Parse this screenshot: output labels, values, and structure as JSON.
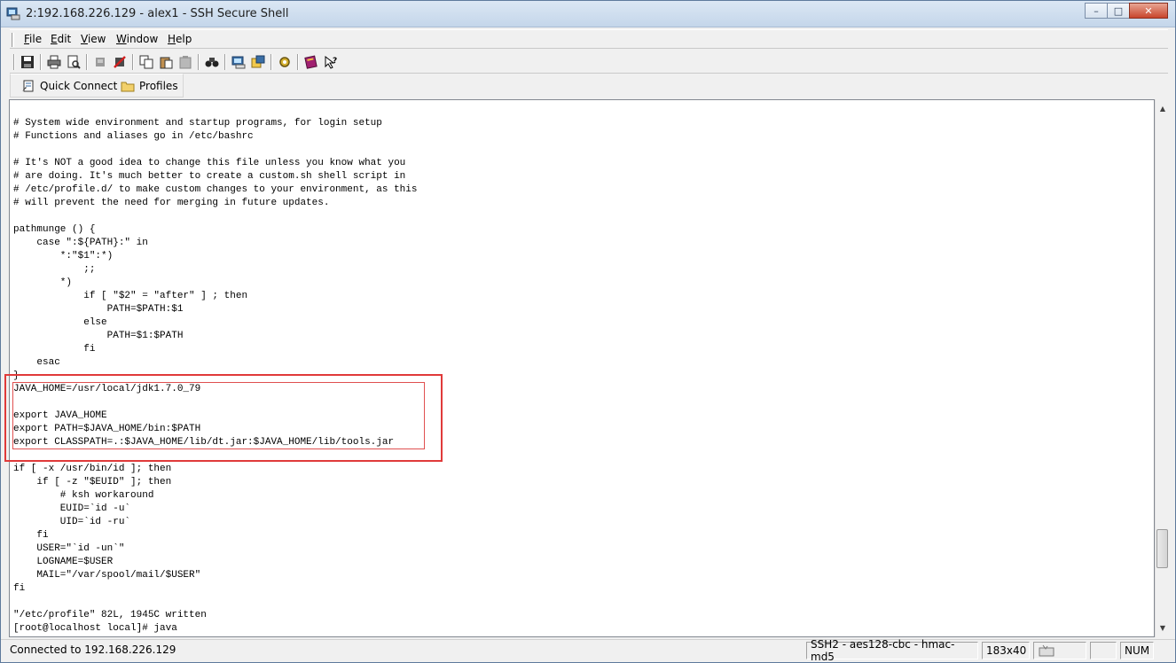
{
  "window": {
    "title": "2:192.168.226.129 - alex1 - SSH Secure Shell",
    "minimize": "–",
    "maximize": "□",
    "close": "✕"
  },
  "menu": [
    {
      "label": "File",
      "accel": "F",
      "rest": "ile"
    },
    {
      "label": "Edit",
      "accel": "E",
      "rest": "dit"
    },
    {
      "label": "View",
      "accel": "V",
      "rest": "iew"
    },
    {
      "label": "Window",
      "accel": "W",
      "rest": "indow"
    },
    {
      "label": "Help",
      "accel": "H",
      "rest": "elp"
    }
  ],
  "toolbar": {
    "icons": [
      "save-icon",
      "print-icon",
      "print-preview-icon",
      "disconnect-icon",
      "disconnect-all-icon",
      "copy-icon",
      "paste-icon",
      "paste-disabled-icon",
      "find-icon",
      "new-terminal-icon",
      "new-file-transfer-icon",
      "settings-icon",
      "help-book-icon",
      "context-help-icon"
    ]
  },
  "quickbar": {
    "quick_connect": "Quick Connect",
    "profiles": "Profiles"
  },
  "terminal": {
    "lines": [
      "# System wide environment and startup programs, for login setup",
      "# Functions and aliases go in /etc/bashrc",
      "",
      "# It's NOT a good idea to change this file unless you know what you",
      "# are doing. It's much better to create a custom.sh shell script in",
      "# /etc/profile.d/ to make custom changes to your environment, as this",
      "# will prevent the need for merging in future updates.",
      "",
      "pathmunge () {",
      "    case \":${PATH}:\" in",
      "        *:\"$1\":*)",
      "            ;;",
      "        *)",
      "            if [ \"$2\" = \"after\" ] ; then",
      "                PATH=$PATH:$1",
      "            else",
      "                PATH=$1:$PATH",
      "            fi",
      "    esac",
      "}",
      "JAVA_HOME=/usr/local/jdk1.7.0_79",
      "",
      "export JAVA_HOME",
      "export PATH=$JAVA_HOME/bin:$PATH",
      "export CLASSPATH=.:$JAVA_HOME/lib/dt.jar:$JAVA_HOME/lib/tools.jar",
      "",
      "if [ -x /usr/bin/id ]; then",
      "    if [ -z \"$EUID\" ]; then",
      "        # ksh workaround",
      "        EUID=`id -u`",
      "        UID=`id -ru`",
      "    fi",
      "    USER=\"`id -un`\"",
      "    LOGNAME=$USER",
      "    MAIL=\"/var/spool/mail/$USER\"",
      "fi",
      "",
      "\"/etc/profile\" 82L, 1945C written",
      "[root@localhost local]# java"
    ]
  },
  "status": {
    "connection": "Connected to 192.168.226.129",
    "cipher": "SSH2 - aes128-cbc - hmac-md5",
    "size": "183x40",
    "num": "NUM"
  }
}
